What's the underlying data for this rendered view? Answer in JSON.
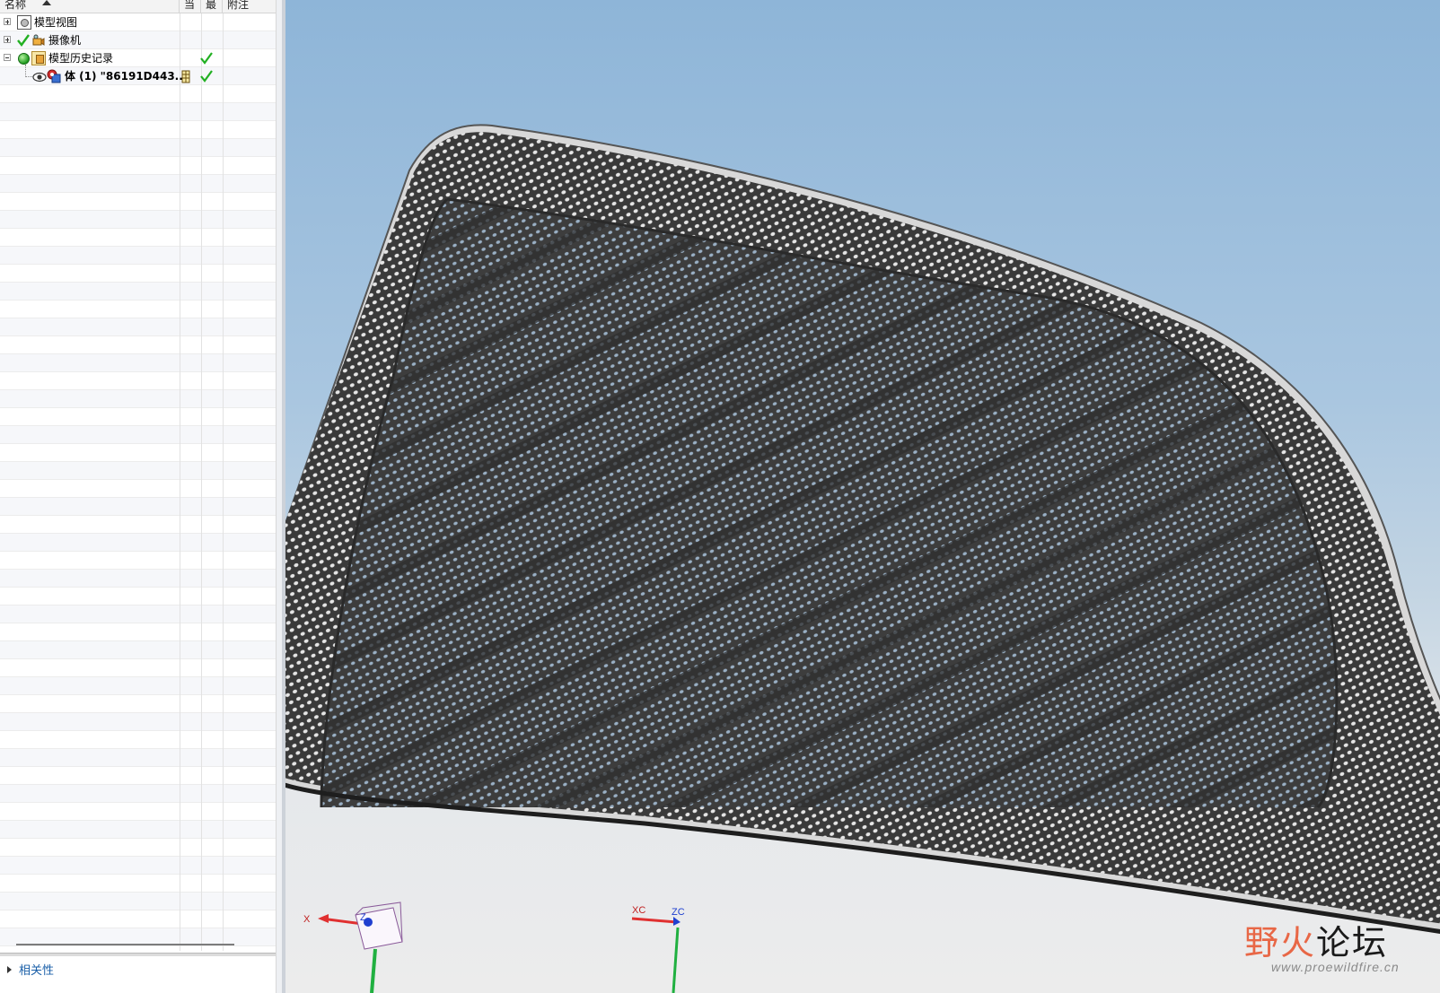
{
  "navigator": {
    "columns": {
      "name": "名称",
      "current": "当",
      "latest": "最",
      "note": "附注"
    },
    "rows": [
      {
        "label": "模型视图",
        "expander": "plus",
        "icon": "model-view-icon"
      },
      {
        "label": "摄像机",
        "expander": "plus",
        "icon": "camera-icon",
        "status": "checked"
      },
      {
        "label": "模型历史记录",
        "expander": "minus",
        "icon": "model-history-icon",
        "status": "ok"
      },
      {
        "label": "体 (1) \"86191D443...",
        "icon": "solid-body-icon",
        "visible": true
      }
    ],
    "bottom_panel": {
      "label": "相关性"
    }
  },
  "viewport": {
    "triad_world": {
      "x_label": "X",
      "z_label": "Z"
    },
    "triad_wcs": {
      "xc_label": "XC",
      "zc_label": "ZC"
    },
    "colors": {
      "x_axis": "#e03030",
      "z_axis": "#2040d0",
      "y_axis": "#20b040",
      "mesh": "#3b3b3b"
    },
    "watermark": {
      "accent_part": "野火",
      "dark_part": "论坛",
      "url": "www.proewildfire.cn"
    }
  }
}
